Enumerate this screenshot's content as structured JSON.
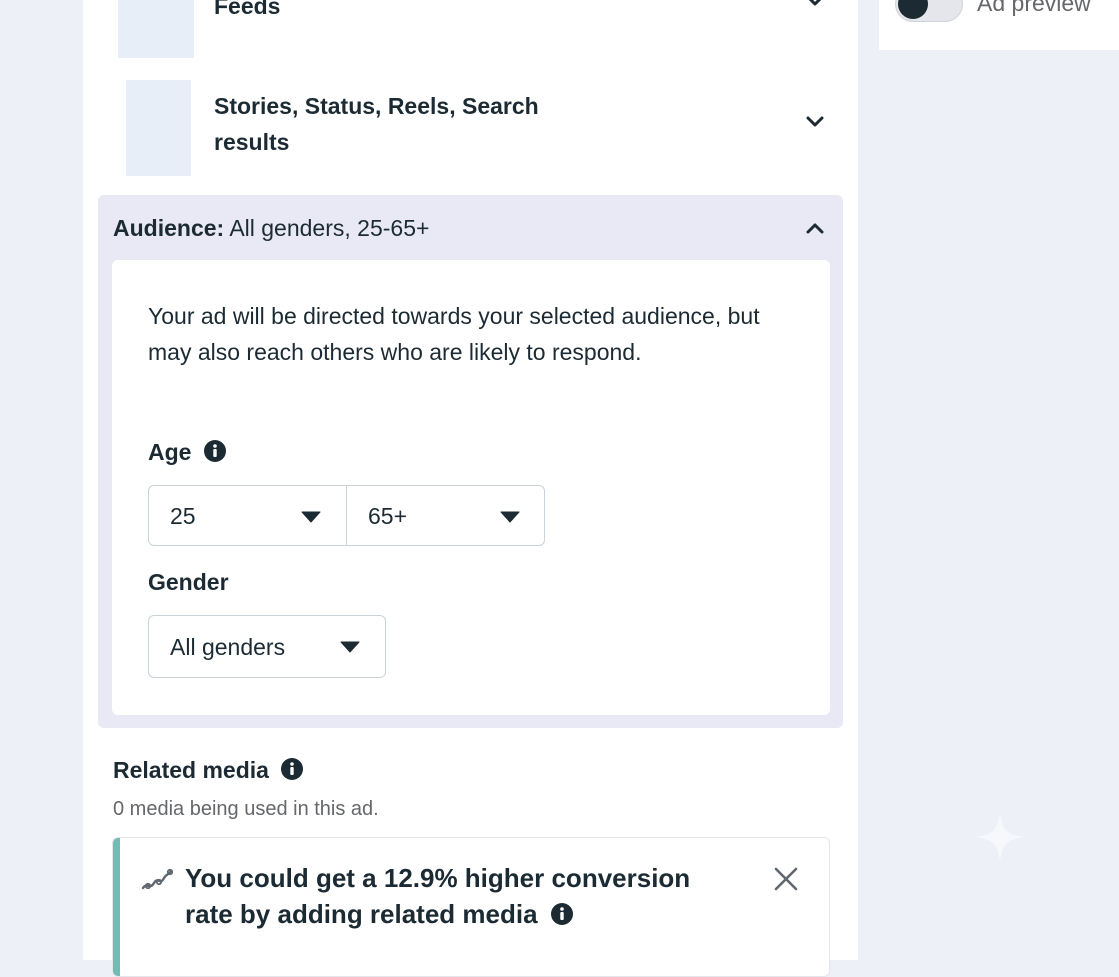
{
  "placements": [
    {
      "title": "Feeds"
    },
    {
      "title": "Stories, Status, Reels, Search results"
    }
  ],
  "audience": {
    "label": "Audience:",
    "summary": "All genders, 25-65+",
    "description": "Your ad will be directed towards your selected audience, but may also reach others who are likely to respond.",
    "age_label": "Age",
    "age_min": "25",
    "age_max": "65+",
    "gender_label": "Gender",
    "gender_value": "All genders"
  },
  "related_media": {
    "title": "Related media",
    "subtitle": "0 media being used in this ad.",
    "tip_text": "You could get a 12.9% higher conversion rate by adding related media"
  },
  "preview": {
    "label": "Ad preview",
    "toggle_on": false
  },
  "colors": {
    "accent_bar": "#72bcb3",
    "page_bg": "#eef0f8",
    "section_bg": "#e8e9f5"
  },
  "icons": [
    "chevron-down-icon",
    "chevron-up-icon",
    "info-icon",
    "caret-down-icon",
    "trend-icon",
    "close-icon"
  ]
}
